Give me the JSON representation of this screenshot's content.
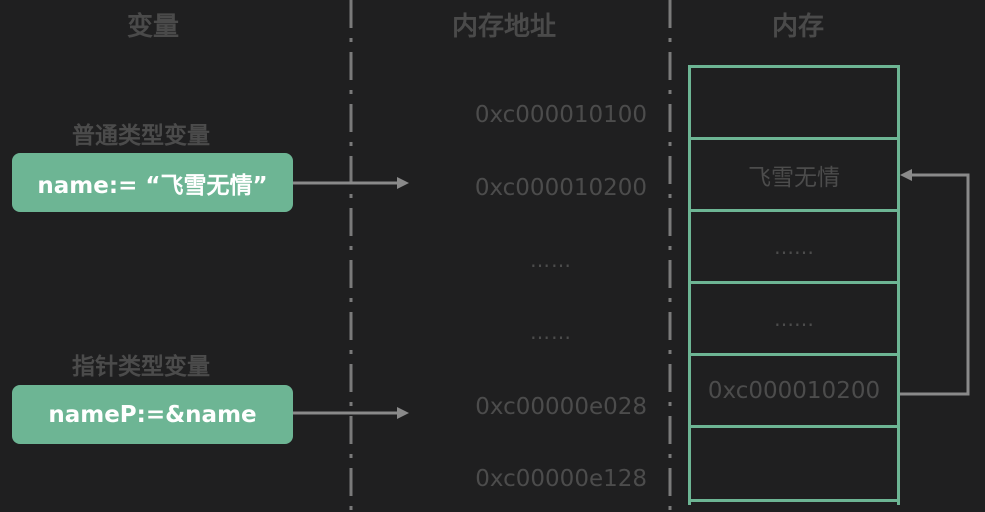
{
  "headers": {
    "variables": "变量",
    "addresses": "内存地址",
    "memory": "内存"
  },
  "sections": {
    "normal": "普通类型变量",
    "pointer": "指针类型变量"
  },
  "variables": {
    "name": "name:= “飞雪无情”",
    "pointer": "nameP:=&name"
  },
  "addresses": [
    "0xc000010100",
    "0xc000010200",
    "……",
    "……",
    "0xc00000e028",
    "0xc00000e128"
  ],
  "memory_cells": [
    "",
    "飞雪无情",
    "……",
    "……",
    "0xc000010200",
    ""
  ],
  "colors": {
    "accent": "#6db594",
    "background": "#1f1f20",
    "muted_text": "#4c4c4c",
    "arrow": "#8a8a8a"
  }
}
